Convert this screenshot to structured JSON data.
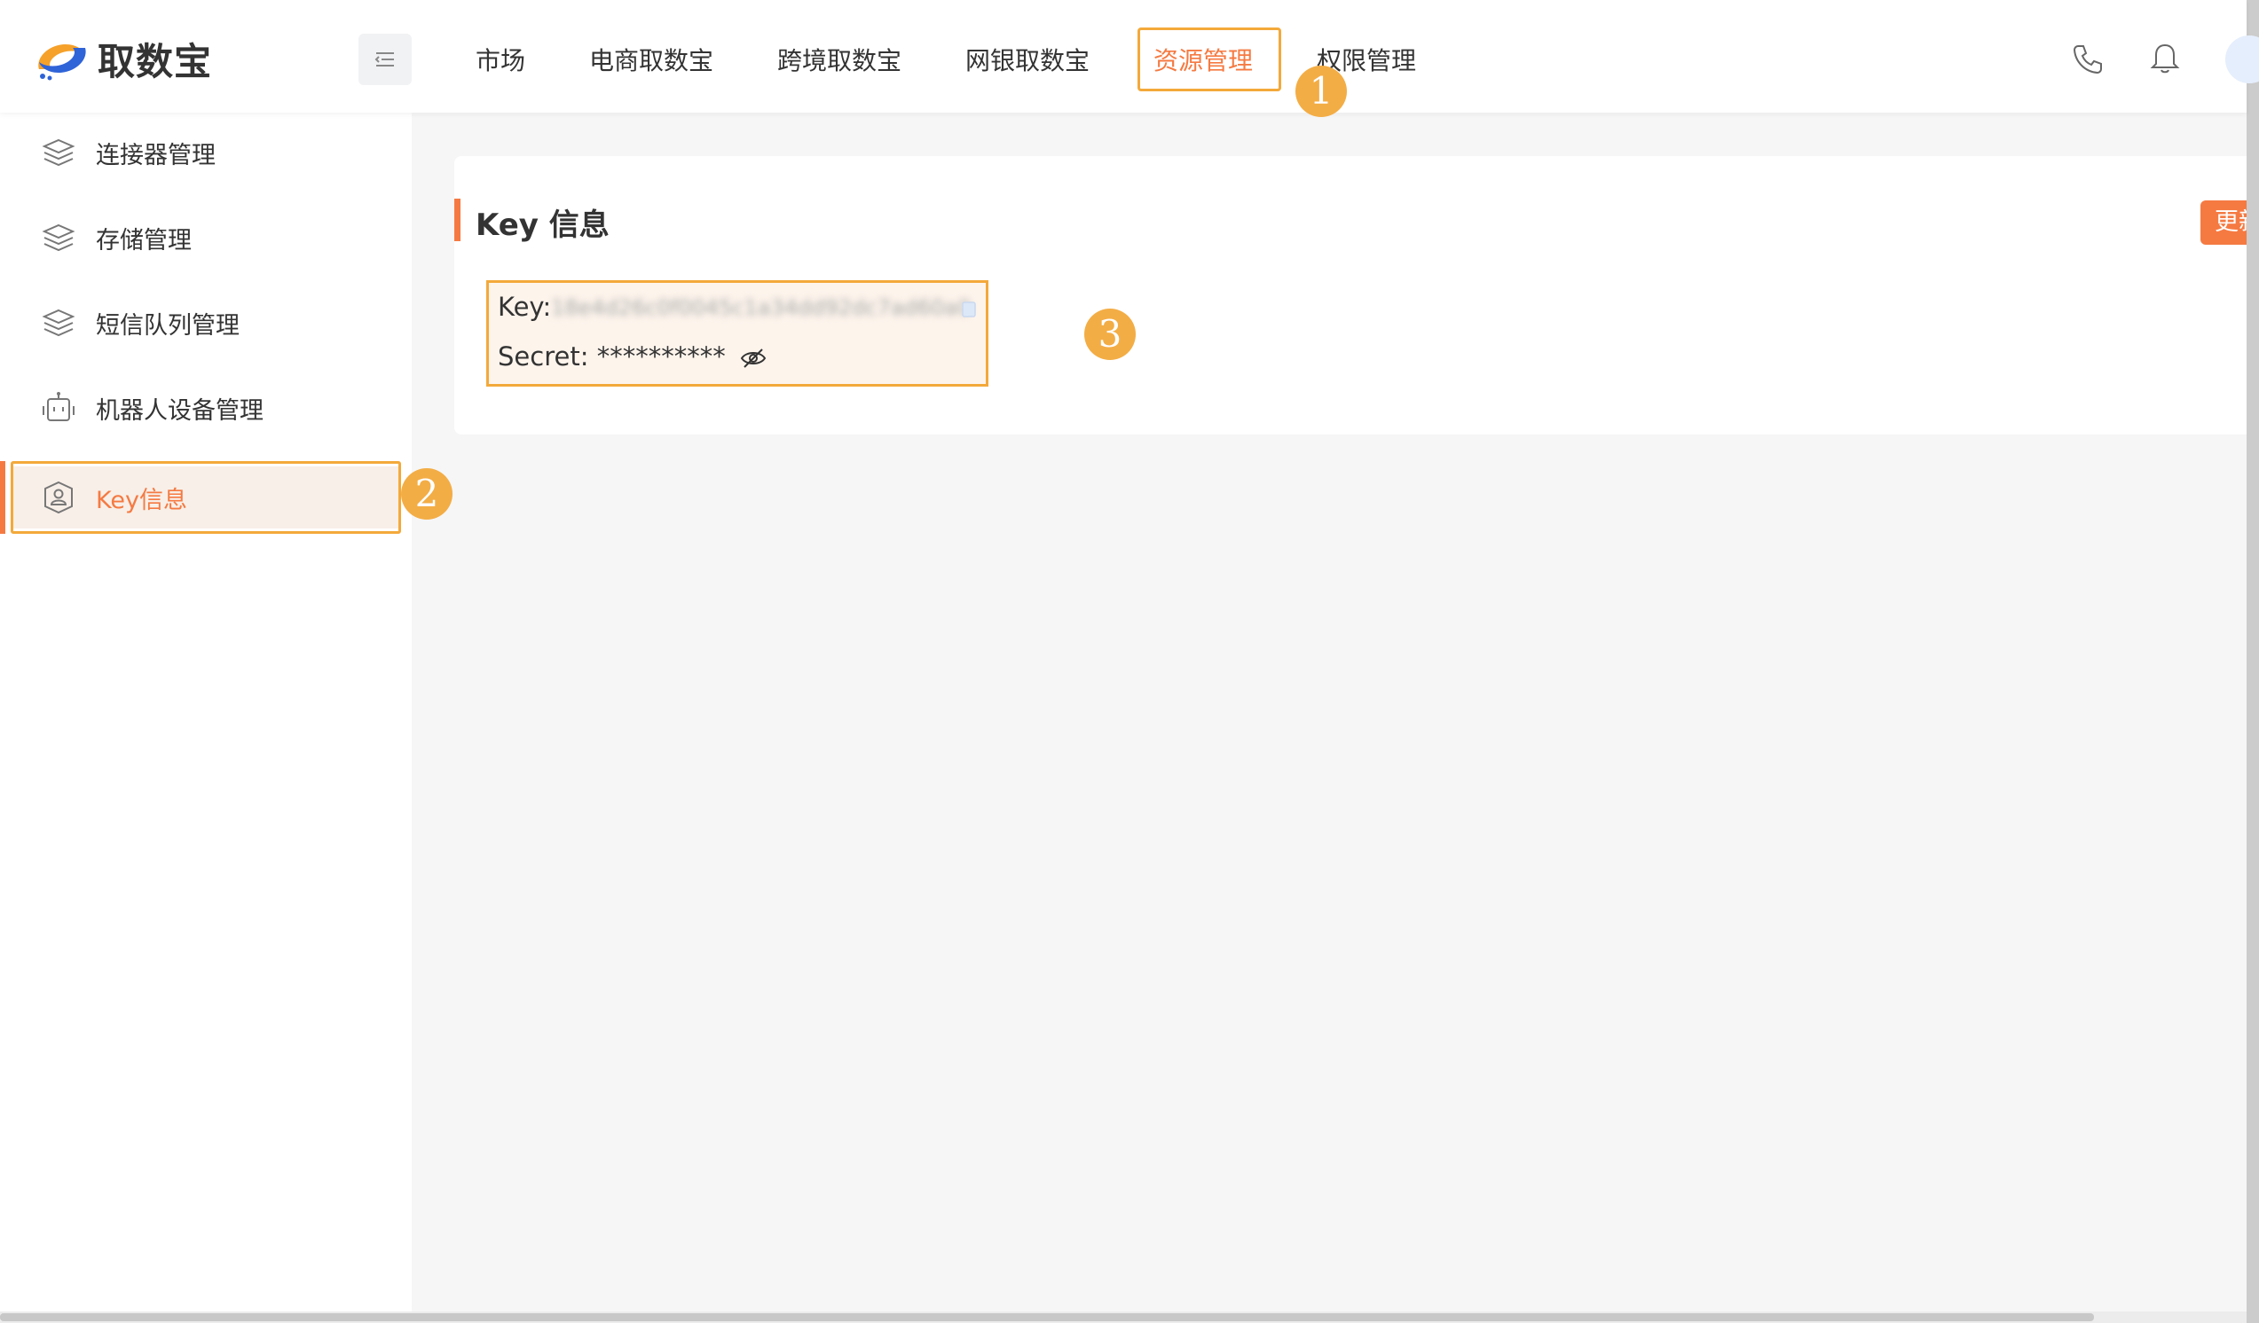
{
  "app": {
    "logo_text": "取数宝"
  },
  "nav": {
    "items": [
      {
        "label": "市场"
      },
      {
        "label": "电商取数宝"
      },
      {
        "label": "跨境取数宝"
      },
      {
        "label": "网银取数宝"
      },
      {
        "label": "资源管理"
      },
      {
        "label": "权限管理"
      }
    ],
    "active": "资源管理"
  },
  "sidebar": {
    "items": [
      {
        "label": "连接器管理",
        "icon": "layers-icon"
      },
      {
        "label": "存储管理",
        "icon": "layers-icon"
      },
      {
        "label": "短信队列管理",
        "icon": "layers-icon"
      },
      {
        "label": "机器人设备管理",
        "icon": "robot-icon"
      },
      {
        "label": "Key信息",
        "icon": "user-shield-icon"
      }
    ],
    "active": "Key信息"
  },
  "card": {
    "title": "Key 信息",
    "update_label": "更新",
    "key_label": "Key:",
    "key_value": "18e4d26c0f0045c1a34dd92dc7ad60a0",
    "secret_label": "Secret:",
    "secret_value": "**********"
  },
  "annotations": {
    "nav_badge": "1",
    "sidebar_badge": "2",
    "info_badge": "3"
  },
  "colors": {
    "accent": "#f57a42",
    "highlight": "#f3a93a",
    "badge": "#f3ad45"
  }
}
